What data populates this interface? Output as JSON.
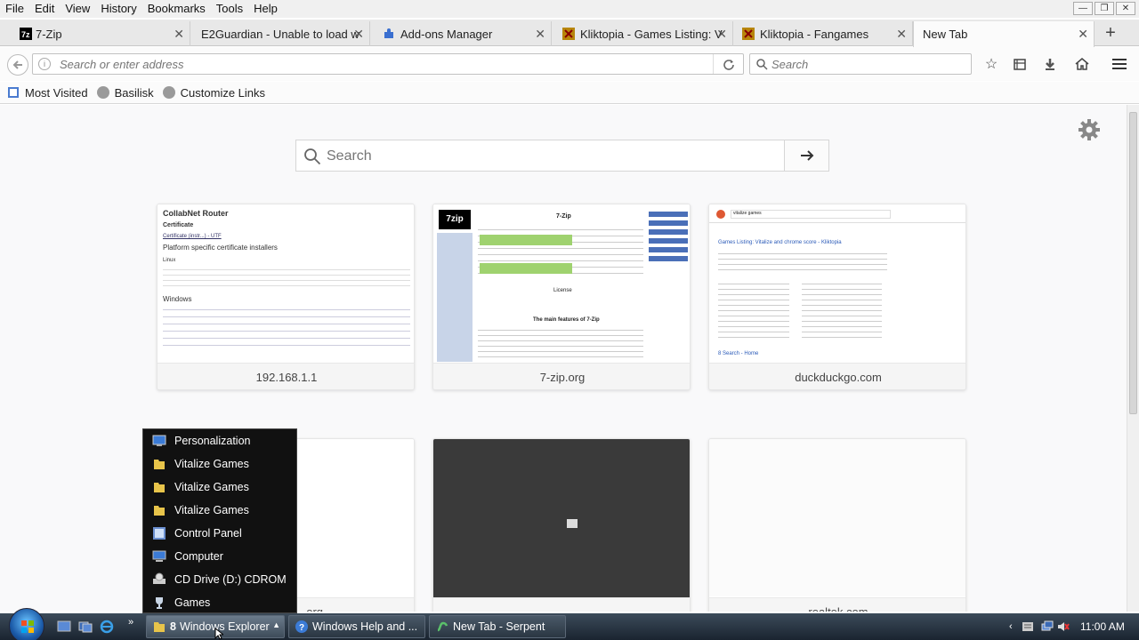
{
  "menubar": {
    "items": [
      "File",
      "Edit",
      "View",
      "History",
      "Bookmarks",
      "Tools",
      "Help"
    ]
  },
  "tabs": [
    {
      "label": "7-Zip",
      "icon": "7zip-icon"
    },
    {
      "label": "E2Guardian - Unable to load w",
      "icon": "e2guardian-icon"
    },
    {
      "label": "Add-ons Manager",
      "icon": "puzzle-icon"
    },
    {
      "label": "Kliktopia - Games Listing: V",
      "icon": "kliktopia-icon"
    },
    {
      "label": "Kliktopia - Fangames",
      "icon": "kliktopia-icon"
    },
    {
      "label": "New Tab",
      "icon": "none"
    }
  ],
  "navbar": {
    "url_placeholder": "Search or enter address",
    "search_placeholder": "Search"
  },
  "bookmarks": [
    "Most Visited",
    "Basilisk",
    "Customize Links"
  ],
  "page": {
    "search_placeholder": "Search",
    "tiles": [
      {
        "label": "192.168.1.1"
      },
      {
        "label": "7-zip.org"
      },
      {
        "label": "duckduckgo.com"
      },
      {
        "label": "...org"
      },
      {
        "label": ""
      },
      {
        "label": "realtek.com"
      }
    ]
  },
  "thumb_192": {
    "title": "CollabNet Router",
    "sub": "Certificate",
    "link1": "Certificate (instr...) - UTF",
    "heading": "Platform specific certificate installers",
    "linux": "Linux",
    "windows": "Windows"
  },
  "thumb_7zip": {
    "logo": "7zip",
    "title": "7-Zip",
    "license": "License",
    "features": "The main features of 7-Zip"
  },
  "thumb_ddg": {
    "query": "vitalize games",
    "result1": "Games Listing: Vitalize and chrome score - Kliktopia",
    "result2": "8 Search - Home"
  },
  "jumplist": [
    {
      "label": "Personalization",
      "icon": "personalization-icon"
    },
    {
      "label": "Vitalize Games",
      "icon": "folder-icon"
    },
    {
      "label": "Vitalize Games",
      "icon": "folder-icon"
    },
    {
      "label": "Vitalize Games",
      "icon": "folder-icon"
    },
    {
      "label": "Control Panel",
      "icon": "control-panel-icon"
    },
    {
      "label": "Computer",
      "icon": "computer-icon"
    },
    {
      "label": "CD Drive (D:) CDROM",
      "icon": "cd-drive-icon"
    },
    {
      "label": "Games",
      "icon": "games-icon"
    }
  ],
  "taskbar": {
    "explorer_count": "8",
    "explorer_label": "Windows Explorer",
    "help_label": "Windows Help and ...",
    "browser_label": "New Tab - Serpent",
    "clock": "11:00 AM"
  },
  "colors": {
    "accent": "#1b5aa8",
    "taskbar": "#2a3642",
    "jumplist_bg": "#111111"
  }
}
